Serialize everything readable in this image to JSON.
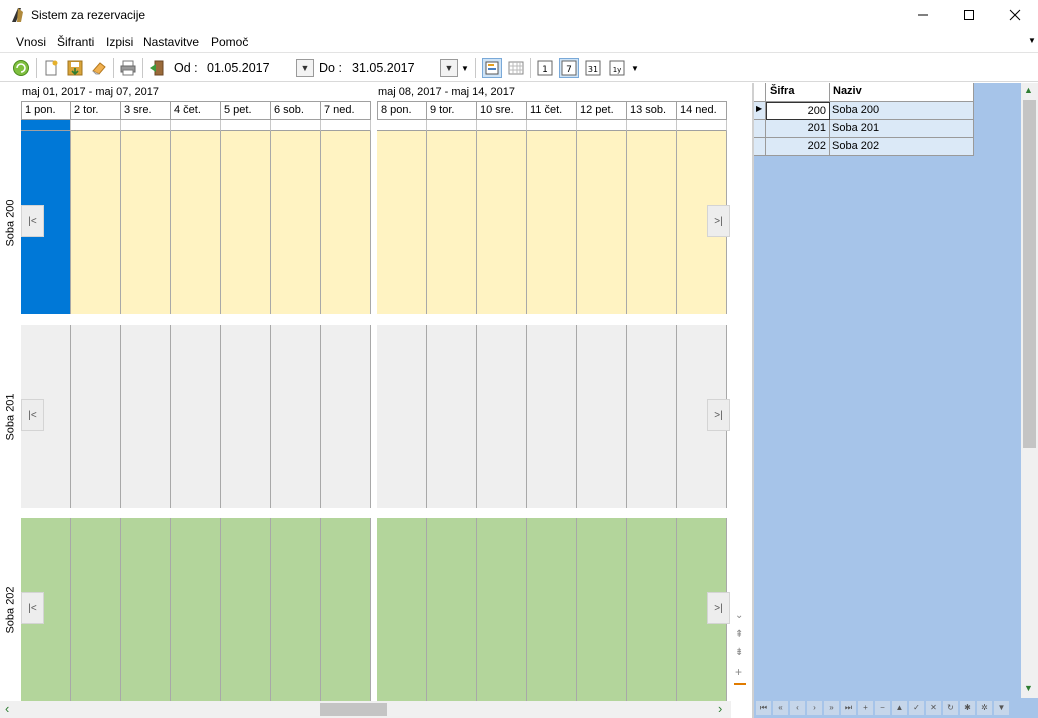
{
  "window": {
    "title": "Sistem za rezervacije"
  },
  "menu": {
    "items": [
      "Vnosi",
      "Šifranti",
      "Izpisi",
      "Nastavitve",
      "Pomoč"
    ]
  },
  "toolbar": {
    "from_label": "Od :",
    "from_value": "01.05.2017",
    "to_label": "Do :",
    "to_value": "31.05.2017"
  },
  "scheduler": {
    "weeks": [
      {
        "title": "maj 01, 2017 - maj 07, 2017",
        "days": [
          "1 pon.",
          "2 tor.",
          "3 sre.",
          "4 čet.",
          "5 pet.",
          "6 sob.",
          "7 ned."
        ]
      },
      {
        "title": "maj 08, 2017 - maj 14, 2017",
        "days": [
          "8 pon.",
          "9 tor.",
          "10 sre.",
          "11 čet.",
          "12 pet.",
          "13 sob.",
          "14 ned."
        ]
      }
    ],
    "rooms": [
      {
        "name": "Soba 200",
        "color": "#fff3c2",
        "highlight_color": "#0078d7"
      },
      {
        "name": "Soba 201",
        "color": "#efefef"
      },
      {
        "name": "Soba 202",
        "color": "#b3d59b"
      }
    ]
  },
  "grid": {
    "headers": {
      "code": "Šifra",
      "name": "Naziv"
    },
    "rows": [
      {
        "code": "200",
        "name": "Soba 200"
      },
      {
        "code": "201",
        "name": "Soba 201"
      },
      {
        "code": "202",
        "name": "Soba 202"
      }
    ]
  }
}
